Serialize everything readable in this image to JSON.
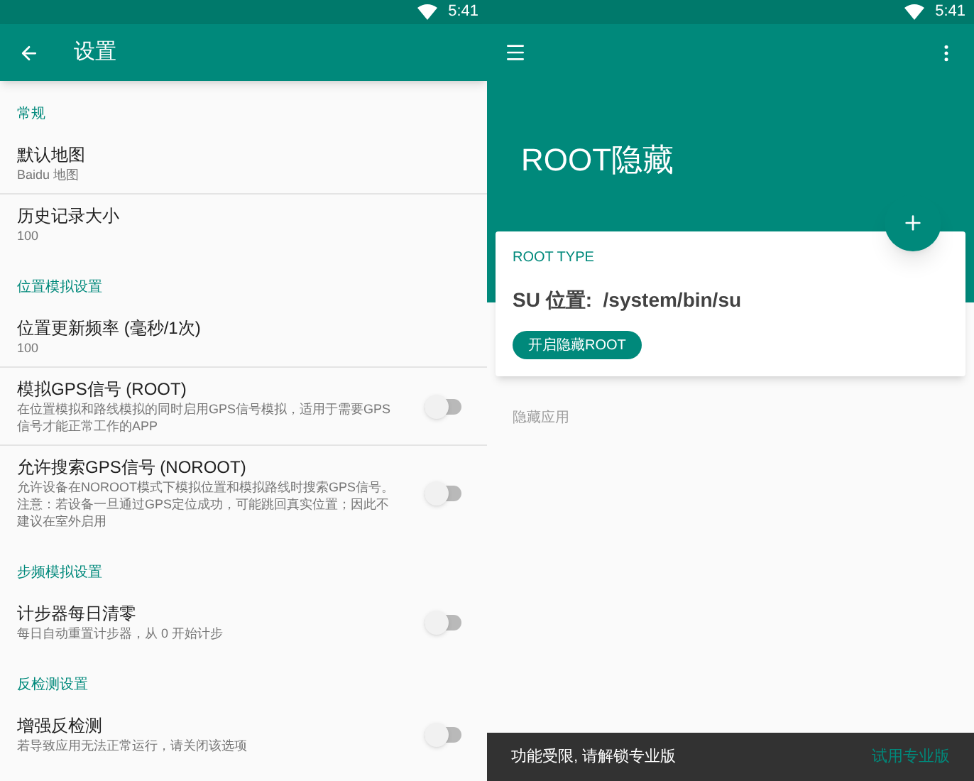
{
  "settings_screen": {
    "status_bar": {
      "time": "5:41"
    },
    "toolbar": {
      "title": "设置"
    },
    "sections": [
      {
        "header": "常规",
        "items": [
          {
            "kind": "text",
            "title": "默认地图",
            "summary": "Baidu 地图"
          },
          {
            "kind": "text",
            "title": "历史记录大小",
            "summary": "100"
          }
        ]
      },
      {
        "header": "位置模拟设置",
        "items": [
          {
            "kind": "text",
            "title": "位置更新频率 (毫秒/1次)",
            "summary": "100"
          },
          {
            "kind": "switch",
            "title": "模拟GPS信号 (ROOT)",
            "summary": "在位置模拟和路线模拟的同时启用GPS信号模拟，适用于需要GPS信号才能正常工作的APP",
            "on": false
          },
          {
            "kind": "switch",
            "title": "允许搜索GPS信号 (NOROOT)",
            "summary": "允许设备在NOROOT模式下模拟位置和模拟路线时搜索GPS信号。注意：若设备一旦通过GPS定位成功，可能跳回真实位置；因此不建议在室外启用",
            "on": false
          }
        ]
      },
      {
        "header": "步频模拟设置",
        "items": [
          {
            "kind": "switch",
            "title": "计步器每日清零",
            "summary": "每日自动重置计步器，从 0 开始计步",
            "on": false
          }
        ]
      },
      {
        "header": "反检测设置",
        "items": [
          {
            "kind": "switch",
            "title": "增强反检测",
            "summary": "若导致应用无法正常运行，请关闭该选项",
            "on": false
          }
        ]
      }
    ]
  },
  "root_screen": {
    "status_bar": {
      "time": "5:41"
    },
    "header": {
      "title": "ROOT隐藏"
    },
    "card": {
      "label": "ROOT TYPE",
      "su_path": "SU 位置:  /system/bin/su",
      "button": "开启隐藏ROOT"
    },
    "section_label": "隐藏应用",
    "snackbar": {
      "message": "功能受限, 请解锁专业版",
      "action": "试用专业版"
    }
  }
}
